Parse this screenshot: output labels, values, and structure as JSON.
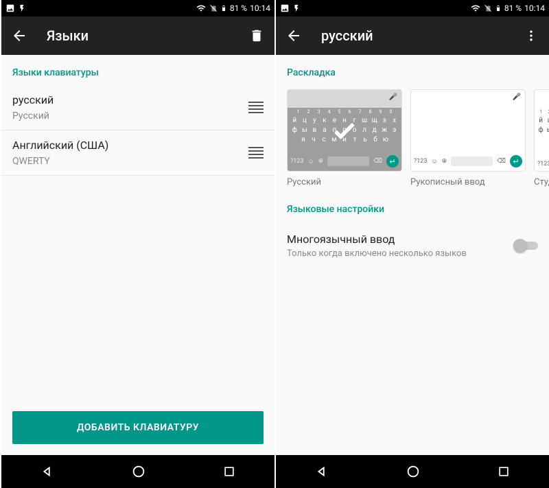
{
  "status": {
    "battery": "81 %",
    "time": "10:14"
  },
  "left": {
    "title": "Языки",
    "section": "Языки клавиатуры",
    "items": [
      {
        "primary": "русский",
        "secondary": "Русский"
      },
      {
        "primary": "Английский (США)",
        "secondary": "QWERTY"
      }
    ],
    "add_button": "ДОБАВИТЬ КЛАВИАТУРУ"
  },
  "right": {
    "title": "русский",
    "section_layout": "Раскладка",
    "layouts": [
      {
        "label": "Русский",
        "selected": true
      },
      {
        "label": "Рукописный ввод",
        "selected": false
      },
      {
        "label": "Студенческая",
        "selected": false
      }
    ],
    "section_settings": "Языковые настройки",
    "multilang": {
      "title": "Многоязычный ввод",
      "subtitle": "Только когда включено несколько языков",
      "enabled": false
    }
  },
  "kbd_sample": {
    "digits": [
      "1",
      "2",
      "3",
      "4",
      "5",
      "6",
      "7",
      "8",
      "9",
      "0"
    ],
    "row1": [
      "й",
      "ц",
      "у",
      "к",
      "е",
      "н",
      "г",
      "ш",
      "щ",
      "з",
      "х"
    ],
    "row2": [
      "ф",
      "ы",
      "в",
      "а",
      "п",
      "р",
      "о",
      "л",
      "д",
      "ж",
      "э"
    ],
    "row3": [
      "я",
      "ч",
      "с",
      "м",
      "и",
      "т",
      "ь",
      "б",
      "ю"
    ],
    "sym": "?123"
  }
}
